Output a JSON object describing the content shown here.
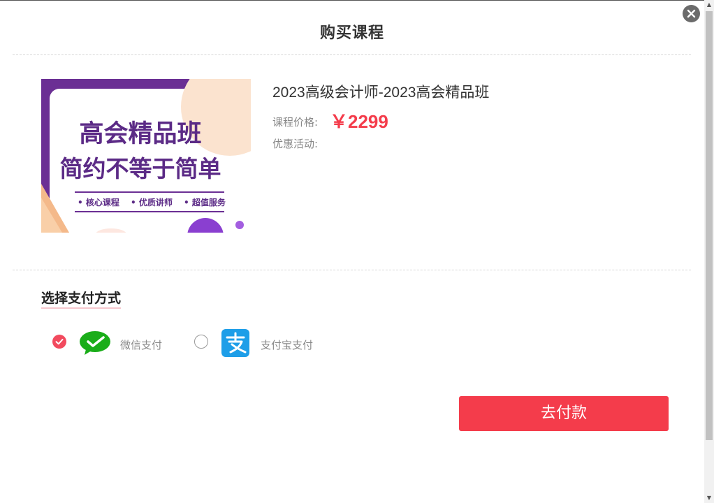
{
  "dialog": {
    "title": "购买课程",
    "close_icon": "close-icon"
  },
  "course": {
    "thumbnail": {
      "headline_1": "高会精品班",
      "headline_2": "简约不等于简单",
      "bullets": [
        "• 核心课程",
        "• 优质讲师",
        "• 超值服务"
      ]
    },
    "name": "2023高级会计师-2023高会精品班",
    "price_label": "课程价格:",
    "price_value": "￥2299",
    "promo_label": "优惠活动:"
  },
  "payment": {
    "heading": "选择支付方式",
    "options": [
      {
        "label": "微信支付",
        "icon": "wechat-pay-icon",
        "selected": true
      },
      {
        "label": "支付宝支付",
        "icon": "alipay-icon",
        "selected": false
      }
    ],
    "submit_label": "去付款"
  },
  "colors": {
    "accent": "#f43c4b",
    "wechat_green": "#1aad19",
    "alipay_blue": "#1e9ee8",
    "thumb_purple": "#6b2f94"
  }
}
